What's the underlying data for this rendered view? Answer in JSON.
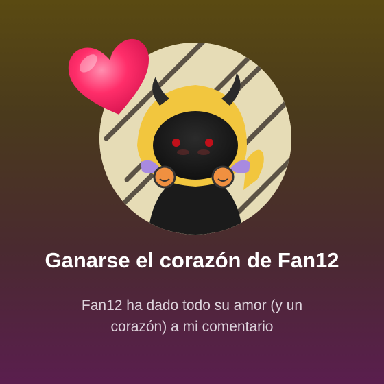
{
  "achievement": {
    "title": "Ganarse el corazón de Fan12",
    "description": "Fan12 ha dado todo su amor (y un corazón) a mi comentario"
  },
  "icons": {
    "heart": "heart-icon",
    "avatar": "avatar-image"
  },
  "colors": {
    "background_top": "#5a4a12",
    "background_bottom": "#5a1e4e",
    "heart": "#ff2e6a",
    "avatar_bg": "#e6dcb6",
    "stripe": "#5b5245"
  }
}
